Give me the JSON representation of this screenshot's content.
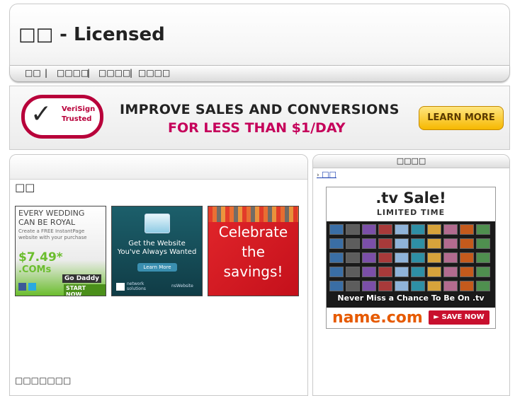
{
  "header": {
    "title": "□□ - Licensed",
    "nav": [
      {
        "label": "□□"
      },
      {
        "label": "□□□□"
      },
      {
        "label": "□□□□"
      },
      {
        "label": "□□□□"
      }
    ],
    "separator": "|"
  },
  "top_banner": {
    "badge_line1": "VeriSign",
    "badge_line2": "Trusted",
    "headline1": "IMPROVE SALES AND CONVERSIONS",
    "headline2": "FOR LESS THAN $1/DAY",
    "button": "LEARN MORE"
  },
  "main": {
    "title": "□□",
    "footer": "□□□□□□□",
    "ads": [
      {
        "l1": "EVERY WEDDING",
        "l2": "CAN BE ROYAL",
        "l3": "Create a FREE InstantPage",
        "l4": "website with your purchase",
        "price": "$7.49*",
        "tld": ".COMs",
        "brand": "Go Daddy",
        "cta": "START NOW"
      },
      {
        "l1": "Get the Website",
        "l2": "You've Always Wanted",
        "cta": "Learn More",
        "brand1": "network",
        "brand2": "solutions",
        "tag": "nsWebsite"
      },
      {
        "l1": "Celebrate",
        "l2": "the",
        "l3": "savings!"
      }
    ]
  },
  "side": {
    "header": "□□□□",
    "link": "□□",
    "tv_ad": {
      "title": ".tv Sale!",
      "subtitle": "LIMITED TIME",
      "tagline": "Never Miss a Chance To Be On .tv",
      "brand": "name.com",
      "cta": "► SAVE NOW"
    }
  },
  "colors": {
    "verisign_red": "#b8003a",
    "headline_pink": "#c5005a",
    "button_gold": "#f6b800",
    "link_blue": "#1a3fb0",
    "tv_orange": "#e65a00"
  }
}
